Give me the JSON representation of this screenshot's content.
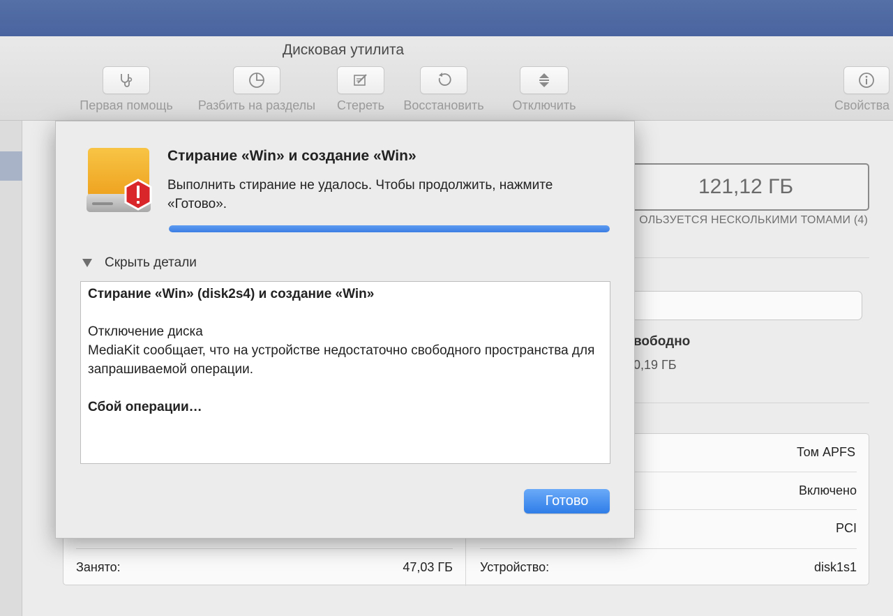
{
  "window": {
    "title": "Дисковая утилита"
  },
  "toolbar": {
    "items": [
      {
        "label": "Первая помощь",
        "icon": "stethoscope-icon"
      },
      {
        "label": "Разбить на разделы",
        "icon": "pie-chart-icon"
      },
      {
        "label": "Стереть",
        "icon": "erase-icon"
      },
      {
        "label": "Восстановить",
        "icon": "restore-icon"
      },
      {
        "label": "Отключить",
        "icon": "unmount-icon"
      },
      {
        "label": "Свойства",
        "icon": "info-icon"
      }
    ]
  },
  "volume": {
    "capacity": "121,12 ГБ",
    "shared_note": "ОЛЬЗУЕТСЯ НЕСКОЛЬКИМИ ТОМАМИ (4)",
    "free_label": "вободно",
    "free_value": "0,19 ГБ"
  },
  "info": {
    "rows_right": [
      {
        "value": "Том APFS"
      },
      {
        "value": "Включено"
      },
      {
        "value": "PCI"
      }
    ],
    "used_label": "Занято:",
    "used_value": "47,03 ГБ",
    "device_label": "Устройство:",
    "device_value": "disk1s1"
  },
  "dialog": {
    "title": "Стирание «Win» и создание «Win»",
    "message": "Выполнить стирание не удалось. Чтобы продолжить, нажмите «Готово».",
    "progress": 1.0,
    "details_toggle": "Скрыть детали",
    "log": {
      "heading": "Стирание «Win» (disk2s4) и создание «Win»",
      "line1": "Отключение диска",
      "line2": "MediaKit сообщает, что на устройстве недостаточно свободного пространства для запрашиваемой операции.",
      "failure": "Сбой операции…"
    },
    "done_label": "Готово"
  },
  "colors": {
    "accent": "#3b7ee3",
    "alert_red": "#d8262a",
    "drive_yellow": "#f4b12b"
  }
}
